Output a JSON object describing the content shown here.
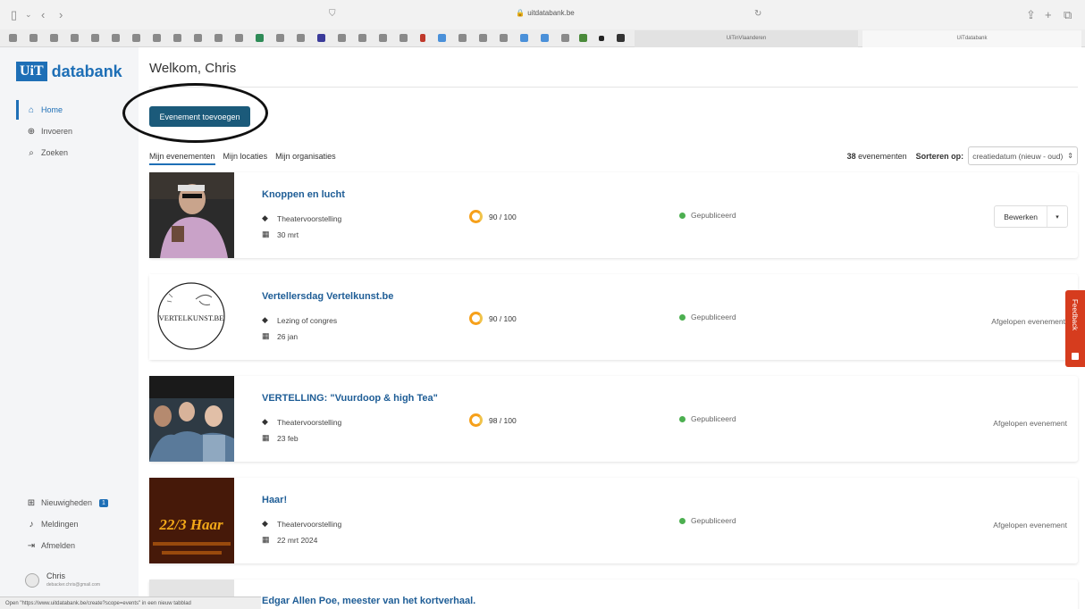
{
  "browser": {
    "url": "uitdatabank.be",
    "tabs": [
      "UiTinVlaanderen",
      "UiTdatabank"
    ],
    "status_url": "Open \"https://www.uitdatabank.be/create?scope=events\" in een nieuw tabblad"
  },
  "sidebar": {
    "logo_mark": "UiT",
    "logo_text": "databank",
    "nav": [
      {
        "label": "Home",
        "icon": "home-icon",
        "active": true
      },
      {
        "label": "Invoeren",
        "icon": "plus-circle-icon"
      },
      {
        "label": "Zoeken",
        "icon": "search-icon"
      }
    ],
    "bottom": [
      {
        "label": "Nieuwigheden",
        "icon": "gift-icon",
        "badge": "1"
      },
      {
        "label": "Meldingen",
        "icon": "bell-icon"
      },
      {
        "label": "Afmelden",
        "icon": "sign-out-icon"
      }
    ],
    "user": {
      "name": "Chris",
      "email": "debacker.chris@gmail.com"
    }
  },
  "main": {
    "welcome": "Welkom, Chris",
    "add_button": "Evenement toevoegen",
    "tabs": [
      "Mijn evenementen",
      "Mijn locaties",
      "Mijn organisaties"
    ],
    "count_num": "38",
    "count_label": "evenementen",
    "sort_label": "Sorteren op:",
    "sort_value": "creatiedatum (nieuw - oud)"
  },
  "events": [
    {
      "title": "Knoppen en lucht",
      "type": "Theatervoorstelling",
      "date": "30 mrt",
      "score": "90 / 100",
      "status": "Gepubliceerd",
      "action": "Bewerken"
    },
    {
      "title": "Vertellersdag Vertelkunst.be",
      "type": "Lezing of congres",
      "date": "26 jan",
      "score": "90 / 100",
      "status": "Gepubliceerd",
      "action": "Afgelopen evenement",
      "thumb_text": "VERTELKUNST.BE"
    },
    {
      "title": "VERTELLING: \"Vuurdoop & high Tea\"",
      "type": "Theatervoorstelling",
      "date": "23 feb",
      "score": "98 / 100",
      "status": "Gepubliceerd",
      "action": "Afgelopen evenement"
    },
    {
      "title": "Haar!",
      "type": "Theatervoorstelling",
      "date": "22 mrt 2024",
      "status": "Gepubliceerd",
      "action": "Afgelopen evenement",
      "thumb_text": "22/3 Haar"
    },
    {
      "title": "Edgar Allen Poe, meester van het kortverhaal."
    }
  ],
  "feedback": "Feedback",
  "colors": {
    "brand": "#1e6fb6",
    "button": "#1b5a7a",
    "feedback": "#d63c1e",
    "published": "#4caf50"
  }
}
